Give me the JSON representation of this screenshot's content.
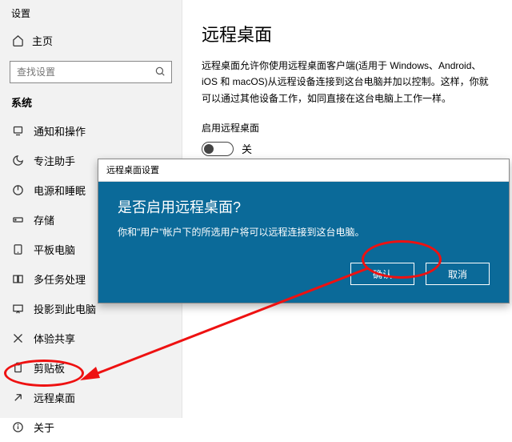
{
  "header": {
    "settings_label": "设置"
  },
  "home": {
    "label": "主页"
  },
  "search": {
    "placeholder": "查找设置"
  },
  "group": {
    "label": "系统"
  },
  "nav": {
    "items": [
      {
        "label": "通知和操作"
      },
      {
        "label": "专注助手"
      },
      {
        "label": "电源和睡眠"
      },
      {
        "label": "存储"
      },
      {
        "label": "平板电脑"
      },
      {
        "label": "多任务处理"
      },
      {
        "label": "投影到此电脑"
      },
      {
        "label": "体验共享"
      },
      {
        "label": "剪贴板"
      },
      {
        "label": "远程桌面"
      },
      {
        "label": "关于"
      }
    ]
  },
  "main": {
    "title": "远程桌面",
    "description": "远程桌面允许你使用远程桌面客户端(适用于 Windows、Android、iOS 和 macOS)从远程设备连接到这台电脑并加以控制。这样，你就可以通过其他设备工作，如同直接在这台电脑上工作一样。",
    "toggle_label": "启用远程桌面",
    "toggle_state": "关"
  },
  "dialog": {
    "title": "远程桌面设置",
    "heading": "是否启用远程桌面?",
    "body": "你和\"用户\"帐户下的所选用户将可以远程连接到这台电脑。",
    "confirm": "确认",
    "cancel": "取消"
  }
}
